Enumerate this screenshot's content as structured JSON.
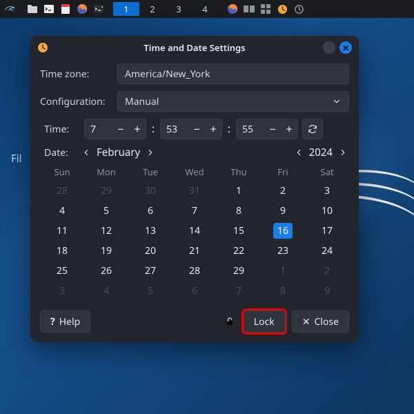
{
  "panel": {
    "workspaces": [
      "1",
      "2",
      "3",
      "4"
    ],
    "active_ws": 0
  },
  "ghost_menu": "Fil",
  "dialog": {
    "title": "Time and Date Settings",
    "timezone_label": "Time zone:",
    "timezone_value": "America/New_York",
    "config_label": "Configuration:",
    "config_value": "Manual",
    "time_label": "Time:",
    "time": {
      "h": "7",
      "m": "53",
      "s": "55"
    },
    "date_label": "Date:",
    "month": "February",
    "year": "2024",
    "dow": [
      "Sun",
      "Mon",
      "Tue",
      "Wed",
      "Thu",
      "Fri",
      "Sat"
    ],
    "weeks": [
      [
        {
          "d": "28",
          "o": true
        },
        {
          "d": "29",
          "o": true
        },
        {
          "d": "30",
          "o": true
        },
        {
          "d": "31",
          "o": true
        },
        {
          "d": "1"
        },
        {
          "d": "2"
        },
        {
          "d": "3"
        }
      ],
      [
        {
          "d": "4"
        },
        {
          "d": "5"
        },
        {
          "d": "6"
        },
        {
          "d": "7"
        },
        {
          "d": "8"
        },
        {
          "d": "9"
        },
        {
          "d": "10"
        }
      ],
      [
        {
          "d": "11"
        },
        {
          "d": "12"
        },
        {
          "d": "13"
        },
        {
          "d": "14"
        },
        {
          "d": "15"
        },
        {
          "d": "16",
          "sel": true
        },
        {
          "d": "17"
        }
      ],
      [
        {
          "d": "18"
        },
        {
          "d": "19"
        },
        {
          "d": "20"
        },
        {
          "d": "21"
        },
        {
          "d": "22"
        },
        {
          "d": "23"
        },
        {
          "d": "24"
        }
      ],
      [
        {
          "d": "25"
        },
        {
          "d": "26"
        },
        {
          "d": "27"
        },
        {
          "d": "28"
        },
        {
          "d": "29"
        },
        {
          "d": "1",
          "o": true
        },
        {
          "d": "2",
          "o": true
        }
      ],
      [
        {
          "d": "3",
          "o": true
        },
        {
          "d": "4",
          "o": true
        },
        {
          "d": "5",
          "o": true
        },
        {
          "d": "6",
          "o": true
        },
        {
          "d": "7",
          "o": true
        },
        {
          "d": "8",
          "o": true
        },
        {
          "d": "9",
          "o": true
        }
      ]
    ],
    "help": "Help",
    "lock": "Lock",
    "close": "Close"
  }
}
